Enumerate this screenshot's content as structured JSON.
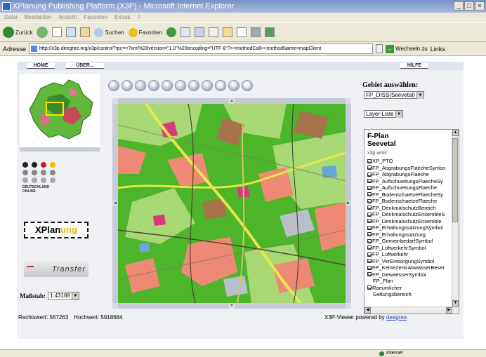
{
  "window": {
    "title": "XPlanung Publishing Platform (X3P) - Microsoft Internet Explorer"
  },
  "menu": {
    "items": [
      "Datei",
      "Bearbeiten",
      "Ansicht",
      "Favoriten",
      "Extras",
      "?"
    ]
  },
  "toolbar": {
    "back_label": "Zurück",
    "search_label": "Suchen",
    "favorites_label": "Favoriten"
  },
  "address": {
    "label": "Adresse",
    "url": "http://x3p.deegree.org/x3p/control?rpc=<?xml%20version=\"1.0\"%20encoding=\"UTF-8\"?><methodCall><methodName>mapClient",
    "go_label": "Wechseln zu",
    "links_label": "Links"
  },
  "nav": {
    "home": "HOME",
    "about": "ÜBER...",
    "help": "HILFE"
  },
  "logos": {
    "dl_line1": "DEUTSCHLAND",
    "dl_line2": "ONLINE",
    "xplan_a": "XPlan",
    "xplan_b": "ung",
    "transfer": "Transfer"
  },
  "scale": {
    "label": "Maßstab:",
    "value": "1:43188"
  },
  "area": {
    "label": "Gebiet auswählen:",
    "value": "FP_DISS(Seevetal)"
  },
  "layer_select": {
    "value": "Layer-Liste"
  },
  "layer_panel": {
    "title_line1": "F-Plan",
    "title_line2": "Seevetal",
    "subtitle": "x3p wms:",
    "layers": [
      {
        "name": "XP_PTO",
        "checked": true
      },
      {
        "name": "FP_AbgrabungsFlaecheSymbo",
        "checked": true
      },
      {
        "name": "FP_AbgrabungsFlaeche",
        "checked": true
      },
      {
        "name": "FP_AufschuettungsFlaecheSy",
        "checked": true
      },
      {
        "name": "FP_AufschuettungsFlaeche",
        "checked": true
      },
      {
        "name": "FP_BodenschaetzeFlaecheSy",
        "checked": true
      },
      {
        "name": "FP_BodenschaetzeFlaeche",
        "checked": true
      },
      {
        "name": "FP_DenkmalschutzBereich",
        "checked": true
      },
      {
        "name": "FP_DenkmalschutzEnsembleS",
        "checked": true
      },
      {
        "name": "FP_DenkmalschutzEnsemble",
        "checked": true
      },
      {
        "name": "FP_ErhaltungssatzungSymbol",
        "checked": true
      },
      {
        "name": "FP_Erhaltungssatzung",
        "checked": true
      },
      {
        "name": "FP_GemeinbedarfSymbol",
        "checked": true
      },
      {
        "name": "FP_LuftverkehrSymbol",
        "checked": true
      },
      {
        "name": "FP_Luftverkehr",
        "checked": true
      },
      {
        "name": "FP_VerEntsorgungSymbol",
        "checked": true
      },
      {
        "name": "FP_KeineZentrAbwasserBeser",
        "checked": true
      },
      {
        "name": "FP_GewaesserSymbol",
        "checked": true
      }
    ],
    "group_label": "FP_Plan",
    "group2": "Raeumlicher",
    "group2_sub": "Geltungsbereich"
  },
  "coords": {
    "east_label": "Rechtswert:",
    "east_value": "567263",
    "north_label": "Hochwert:",
    "north_value": "5918684"
  },
  "powered": {
    "text": "X3P-Viewer powered by",
    "link": "deegree"
  },
  "status": {
    "zone": "Internet"
  },
  "colors": {
    "map_green": "#4cb52a",
    "map_lightgreen": "#a7d873",
    "map_salmon": "#ee8a73",
    "map_brown": "#a8724a",
    "map_yellow": "#e6e64e"
  }
}
